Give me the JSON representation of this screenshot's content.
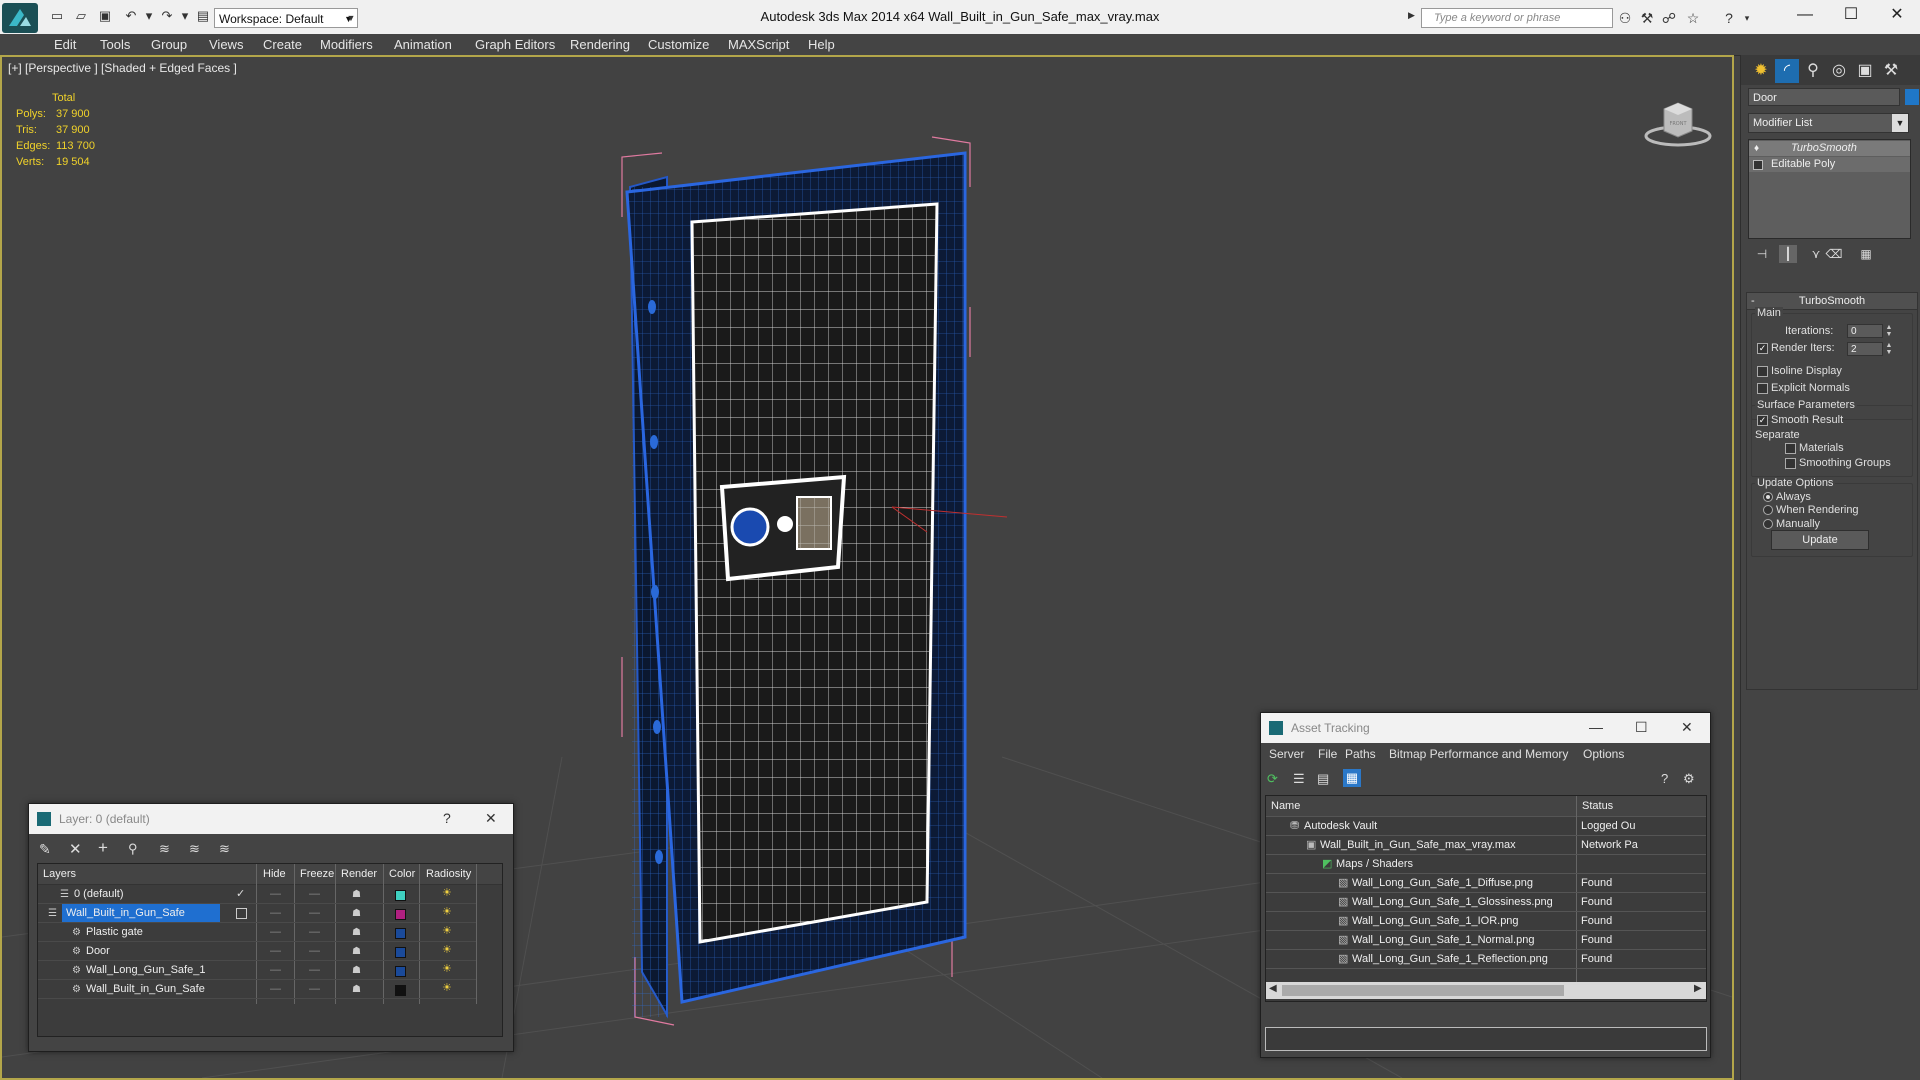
{
  "app": {
    "title": "Autodesk 3ds Max  2014 x64     Wall_Built_in_Gun_Safe_max_vray.max",
    "workspace": "Workspace: Default",
    "search_placeholder": "Type a keyword or phrase"
  },
  "menu": [
    "Edit",
    "Tools",
    "Group",
    "Views",
    "Create",
    "Modifiers",
    "Animation",
    "Graph Editors",
    "Rendering",
    "Customize",
    "MAXScript",
    "Help"
  ],
  "viewport": {
    "label": "[+] [Perspective ] [Shaded + Edged Faces ]",
    "stats": {
      "total_label": "Total",
      "polys_label": "Polys:",
      "polys": "37 900",
      "tris_label": "Tris:",
      "tris": "37 900",
      "edges_label": "Edges:",
      "edges": "113 700",
      "verts_label": "Verts:",
      "verts": "19 504"
    },
    "viewcube_label": "FRONT"
  },
  "command_panel": {
    "object_name": "Door",
    "object_color": "#1f77c8",
    "modifier_list": "Modifier List",
    "stack": [
      "TurboSmooth",
      "Editable Poly"
    ],
    "rollout_title": "TurboSmooth",
    "main_label": "Main",
    "iterations_label": "Iterations:",
    "iterations": "0",
    "render_iters_label": "Render Iters:",
    "render_iters": "2",
    "isoline_label": "Isoline Display",
    "explicit_normals_label": "Explicit Normals",
    "surface_params_label": "Surface Parameters",
    "smooth_result_label": "Smooth Result",
    "separate_label": "Separate",
    "materials_label": "Materials",
    "smoothing_groups_label": "Smoothing Groups",
    "update_options_label": "Update Options",
    "always_label": "Always",
    "when_rendering_label": "When Rendering",
    "manually_label": "Manually",
    "update_button": "Update"
  },
  "layer_window": {
    "title": "Layer: 0 (default)",
    "help": "?",
    "columns": [
      "Layers",
      "Hide",
      "Freeze",
      "Render",
      "Color",
      "Radiosity"
    ],
    "rows": [
      {
        "name": "0 (default)",
        "color": "#3fd0c0",
        "indent": 1
      },
      {
        "name": "Wall_Built_in_Gun_Safe",
        "color": "#b02080",
        "indent": 0
      },
      {
        "name": "Plastic gate",
        "color": "#1a4a9a",
        "indent": 2
      },
      {
        "name": "Door",
        "color": "#1a4a9a",
        "indent": 2
      },
      {
        "name": "Wall_Long_Gun_Safe_1",
        "color": "#1a4a9a",
        "indent": 2
      },
      {
        "name": "Wall_Built_in_Gun_Safe",
        "color": "#111111",
        "indent": 2
      }
    ]
  },
  "asset_window": {
    "title": "Asset Tracking",
    "menu": [
      "Server",
      "File",
      "Paths",
      "Bitmap Performance and Memory",
      "Options"
    ],
    "columns": [
      "Name",
      "Status"
    ],
    "rows": [
      {
        "name": "Autodesk Vault",
        "status": "Logged Ou",
        "indent": 1
      },
      {
        "name": "Wall_Built_in_Gun_Safe_max_vray.max",
        "status": "Network Pa",
        "indent": 2
      },
      {
        "name": "Maps / Shaders",
        "status": "",
        "indent": 3
      },
      {
        "name": "Wall_Long_Gun_Safe_1_Diffuse.png",
        "status": "Found",
        "indent": 4
      },
      {
        "name": "Wall_Long_Gun_Safe_1_Glossiness.png",
        "status": "Found",
        "indent": 4
      },
      {
        "name": "Wall_Long_Gun_Safe_1_IOR.png",
        "status": "Found",
        "indent": 4
      },
      {
        "name": "Wall_Long_Gun_Safe_1_Normal.png",
        "status": "Found",
        "indent": 4
      },
      {
        "name": "Wall_Long_Gun_Safe_1_Reflection.png",
        "status": "Found",
        "indent": 4
      }
    ]
  }
}
